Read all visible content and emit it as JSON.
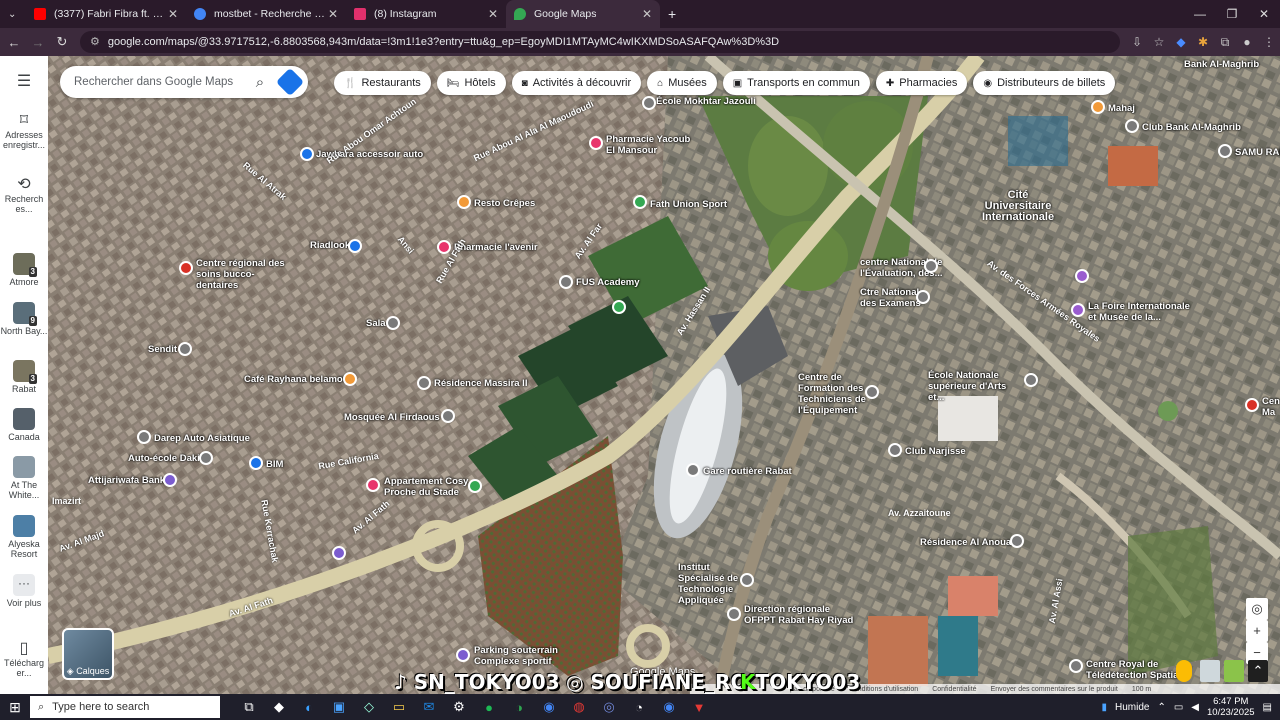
{
  "browser": {
    "tabs": [
      {
        "title": "(3377) Fabri Fibra ft. Emma, Bal",
        "favicon_color": "#ff0000"
      },
      {
        "title": "mostbet - Recherche Google",
        "favicon_color": "#4285f4"
      },
      {
        "title": "(8) Instagram",
        "favicon_color": "#e1306c"
      },
      {
        "title": "Google Maps",
        "favicon_color": "#34a853"
      }
    ],
    "url": "google.com/maps/@33.9717512,-6.8803568,943m/data=!3m1!1e3?entry=ttu&g_ep=EgoyMDI1MTAyMC4wIKXMDSoASAFQAw%3D%3D"
  },
  "sidebar": {
    "menu_icon": "hamburger-icon",
    "items": [
      {
        "label": "Adresses enregistr...",
        "icon": "bookmark-icon"
      },
      {
        "label": "Recherch es...",
        "icon": "history-icon"
      },
      {
        "label": "Atmore",
        "badge": "3"
      },
      {
        "label": "North Bay...",
        "badge": "9"
      },
      {
        "label": "Rabat",
        "badge": "3"
      },
      {
        "label": "Canada"
      },
      {
        "label": "At The White..."
      },
      {
        "label": "Alyeska Resort"
      },
      {
        "label": "Voir plus"
      },
      {
        "label": "Télécharg er..."
      }
    ]
  },
  "search": {
    "placeholder": "Rechercher dans Google Maps"
  },
  "chips": [
    "Restaurants",
    "Hôtels",
    "Activités à découvrir",
    "Musées",
    "Transports en commun",
    "Pharmacies",
    "Distributeurs de billets"
  ],
  "map_labels": {
    "ecole": "École Mokhtar Jazouli",
    "pharmacie_yacoub": "Pharmacie Yacoub El Mansour",
    "fath_union": "Fath Union Sport",
    "jawhara": "Jawhara accessoir auto",
    "resto": "Resto Crêpes",
    "pharmacie_avenir": "Pharmacie l'avenir",
    "riadlook": "Riadlook",
    "centre_bucco": "Centre régional des soins bucco-dentaires",
    "fus": "FUS Academy",
    "sala": "Sala",
    "sendit": "Sendit",
    "cafe": "Café Rayhana belamou",
    "residence_massira": "Résidence Massira II",
    "mosquee": "Mosquée Al Firdaous",
    "darep": "Darep Auto Asiatique",
    "autoecole": "Auto-école Dakik",
    "bim": "BIM",
    "attijari": "Attijariwafa Bank",
    "appartement": "Appartement Cosy Proche du Stade",
    "gare": "Gare routière Rabat",
    "institut": "Institut Spécialisé de Technologie Appliquée",
    "direction": "Direction régionale OFPPT Rabat Hay Riyad",
    "parking": "Parking souterrain Complexe sportif",
    "centre_eval": "centre National de l'Évaluation, des...",
    "ctre_examens": "Ctre National des Examens",
    "cite": "Cité Universitaire Internationale",
    "club_bank": "Club Bank Al-Maghrib",
    "bank_maghrib": "Bank Al-Maghrib",
    "mahaj": "Mahaj",
    "samu": "SAMU RAB",
    "foire": "La Foire Internationale et Musée de la...",
    "centre_formation": "Centre de Formation des Techniciens de l'Équipement",
    "ecole_nationale": "École Nationale supérieure d'Arts et...",
    "club_narjisse": "Club Narjisse",
    "residence_anouar": "Résidence Al Anouar",
    "centre_royal": "Centre Royal de Télédétection Spatia",
    "hospital": "Cen Ma",
    "av_azzaitoune": "Av. Azzaitoune",
    "av_fath": "Av. Al Fath",
    "rue_california": "Rue California",
    "av_hassan": "Av. Hassan II",
    "av_far": "Av. Al Far",
    "av_forces": "Av. des Forces Armées Royales",
    "av_majd": "Av. Al Majd",
    "av_fath2": "Av. Al Fath",
    "av_assi": "Av. Al Assi",
    "imazirt": "Imazirt",
    "rue_omar": "Rue Abou Omar Achtoun",
    "al_atrak": "Rue Al Atrak",
    "rue_fath": "Rue Al Fath",
    "ansi": "Ansi",
    "rue_kerma": "Rue Kerrachak",
    "al_ala": "Rue Abou Al Ala Al Maoudoudi"
  },
  "overlays": [
    "SN_TOKYO03",
    "SOUFIANE_RO",
    "TOKYO03"
  ],
  "map_footer": {
    "google": "Google Maps",
    "items": [
      "pas disponible",
      "Conditions d'utilisation",
      "Confidentialité",
      "Envoyer des commentaires sur le produit",
      "100 m"
    ]
  },
  "layers_label": "Calques",
  "taskbar": {
    "search_placeholder": "Type here to search",
    "weather": "Humide",
    "time": "6:47 PM",
    "date": "10/23/2025"
  }
}
